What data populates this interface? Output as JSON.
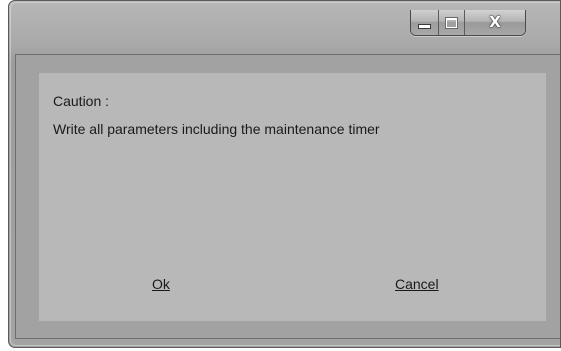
{
  "window": {
    "caption_buttons": {
      "minimize_icon": "minimize-icon",
      "maximize_icon": "maximize-icon",
      "close_label": "X"
    }
  },
  "dialog": {
    "caution_label": "Caution :",
    "message": "Write all parameters including the maintenance timer",
    "ok_label": "Ok",
    "cancel_label": "Cancel"
  }
}
